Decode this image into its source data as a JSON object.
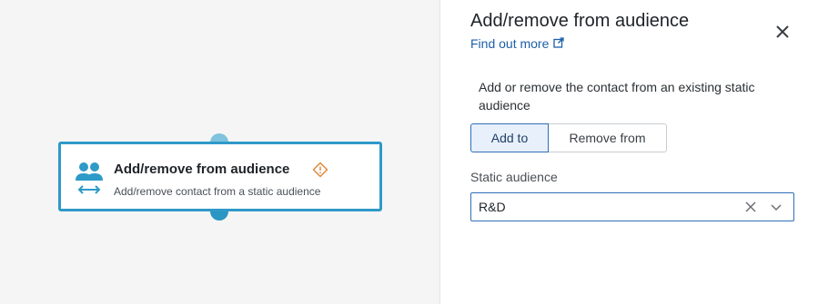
{
  "node": {
    "title": "Add/remove from audience",
    "subtitle": "Add/remove contact from a static audience",
    "icon": "audience-sync-icon",
    "accent_color": "#2e9ac8",
    "warning_color": "#e08a3c"
  },
  "panel": {
    "title": "Add/remove from audience",
    "find_out_more": "Find out more",
    "description": "Add or remove the contact from an existing static audience",
    "mode_options": [
      "Add to",
      "Remove from"
    ],
    "selected_mode": "Add to",
    "field_label": "Static audience",
    "selected_audience": "R&D",
    "link_color": "#1c5fa8"
  }
}
